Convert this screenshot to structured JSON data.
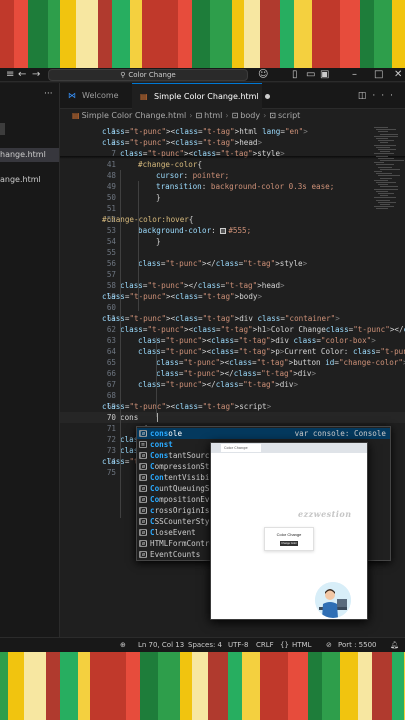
{
  "window": {
    "search_label": "Color Change",
    "title_icons": [
      "back-arrow-icon",
      "forward-arrow-icon",
      "copilot-icon",
      "layout-icon",
      "minimize-icon",
      "maximize-icon",
      "close-icon"
    ]
  },
  "sidebar": {
    "more_label": "···",
    "files": [
      {
        "label": "hange.html",
        "active": true
      },
      {
        "label": "ange.html",
        "active": false
      }
    ]
  },
  "tabs": [
    {
      "label": "Welcome",
      "icon": "vscode-icon",
      "active": false
    },
    {
      "label": "Simple Color Change.html",
      "icon": "html-file-icon",
      "active": true,
      "modified": true
    }
  ],
  "breadcrumb": {
    "file": "Simple Color Change.html",
    "items": [
      "html",
      "body",
      "script"
    ]
  },
  "editor": {
    "current_line": 70,
    "lines": [
      {
        "n": "1",
        "code": "<html lang=\"en\">"
      },
      {
        "n": "2",
        "code": "<head>"
      },
      {
        "n": "7",
        "code": "<style>"
      },
      {
        "n": "41",
        "code": "#change-color{"
      },
      {
        "n": "48",
        "code": "cursor: pointer;"
      },
      {
        "n": "49",
        "code": "transition: background-color 0.3s ease;"
      },
      {
        "n": "50",
        "code": "}"
      },
      {
        "n": "51",
        "code": ""
      },
      {
        "n": "52",
        "code": "#change-color:hover{"
      },
      {
        "n": "53",
        "code": "background-color: #555;"
      },
      {
        "n": "54",
        "code": "}"
      },
      {
        "n": "55",
        "code": ""
      },
      {
        "n": "56",
        "code": "</style>"
      },
      {
        "n": "57",
        "code": ""
      },
      {
        "n": "58",
        "code": "</head>"
      },
      {
        "n": "59",
        "code": "<body>"
      },
      {
        "n": "60",
        "code": ""
      },
      {
        "n": "61",
        "code": "<div class=\"container\">"
      },
      {
        "n": "62",
        "code": "<h1>Color Change</h1>"
      },
      {
        "n": "63",
        "code": "<div class=\"color-box\">"
      },
      {
        "n": "64",
        "code": "<p>Current Color: <span id=\"color-code\">#FFFFFF"
      },
      {
        "n": "65",
        "code": "<button id=\"change-color\">Change Color</button>"
      },
      {
        "n": "66",
        "code": "</div>"
      },
      {
        "n": "67",
        "code": "</div>"
      },
      {
        "n": "68",
        "code": ""
      },
      {
        "n": "69",
        "code": "<script>"
      },
      {
        "n": "70",
        "code": "cons"
      },
      {
        "n": "71",
        "code": "</"
      },
      {
        "n": "72",
        "code": "</s"
      },
      {
        "n": "73",
        "code": "</body>"
      },
      {
        "n": "74",
        "code": "</html>"
      },
      {
        "n": "75",
        "code": ""
      }
    ]
  },
  "suggest": {
    "items": [
      {
        "label": "console",
        "match": "cons",
        "rest": "ole",
        "icon": "variable-icon",
        "detail": "var console: Console",
        "selected": true
      },
      {
        "label": "const",
        "match": "const",
        "rest": "",
        "icon": "keyword-icon",
        "detail": ""
      },
      {
        "label": "ConstantSource",
        "match": "Cons",
        "rest": "tantSource",
        "icon": "variable-icon",
        "detail": ""
      },
      {
        "label": "CompressionStr",
        "match": "C",
        "rest": "ompressionStr",
        "icon": "variable-icon",
        "detail": ""
      },
      {
        "label": "ContentVisibil",
        "match": "Con",
        "rest": "tentVisibil",
        "icon": "variable-icon",
        "detail": ""
      },
      {
        "label": "CountQueuingSt",
        "match": "Co",
        "rest": "untQueuingSt",
        "icon": "variable-icon",
        "detail": ""
      },
      {
        "label": "CompositionEve",
        "match": "Co",
        "rest": "mpositionEve",
        "icon": "variable-icon",
        "detail": ""
      },
      {
        "label": "crossOriginIso",
        "match": "c",
        "rest": "rossOriginIso",
        "icon": "variable-icon",
        "detail": ""
      },
      {
        "label": "CSSCounterStyl",
        "match": "C",
        "rest": "SSCounterStyl",
        "icon": "variable-icon",
        "detail": ""
      },
      {
        "label": "CloseEvent",
        "match": "C",
        "rest": "loseEvent",
        "icon": "variable-icon",
        "detail": ""
      },
      {
        "label": "HTMLFormContro",
        "match": "",
        "rest": "HTMLFormContro",
        "icon": "variable-icon",
        "detail": ""
      },
      {
        "label": "EventCounts",
        "match": "",
        "rest": "EventCounts",
        "icon": "variable-icon",
        "detail": ""
      }
    ]
  },
  "preview": {
    "tab_label": "Color Change",
    "watermark": "ezzwestion",
    "heading": "Color Change",
    "button": "Change Color"
  },
  "status": {
    "cursor": "Ln 70, Col 13",
    "spaces": "Spaces: 4",
    "encoding": "UTF-8",
    "eol": "CRLF",
    "language": "HTML",
    "port": "Port : 5500"
  },
  "colors": {
    "accent": "#0078d4",
    "background": "#1f1f1f",
    "selection": "#04395e"
  }
}
